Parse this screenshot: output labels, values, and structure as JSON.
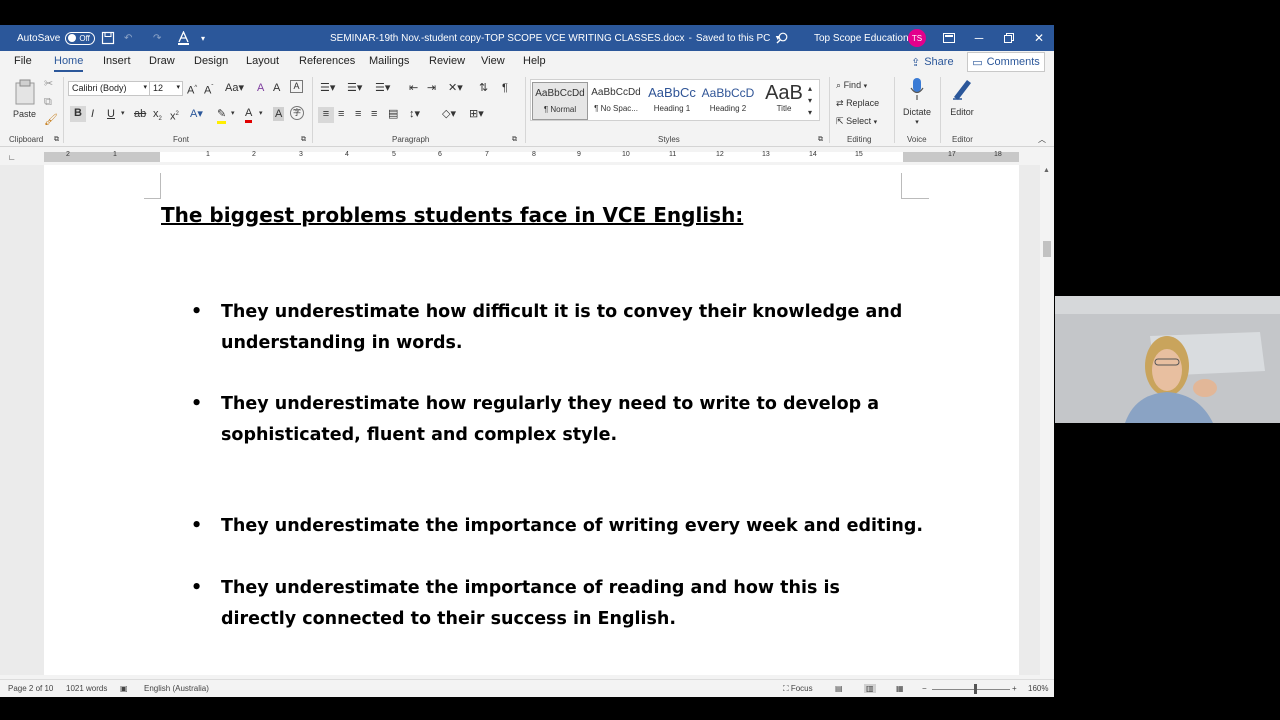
{
  "titlebar": {
    "autosave_label": "AutoSave",
    "autosave_state": "Off",
    "document_title": "SEMINAR-19th Nov.-student copy-TOP SCOPE VCE WRITING CLASSES.docx",
    "save_status": "Saved to this PC",
    "account_name": "Top Scope Education",
    "avatar_initials": "TS",
    "accent_color": "#2b579a"
  },
  "menu": {
    "tabs": [
      "File",
      "Home",
      "Insert",
      "Draw",
      "Design",
      "Layout",
      "References",
      "Mailings",
      "Review",
      "View",
      "Help"
    ],
    "active_tab": "Home",
    "share_label": "Share",
    "comments_label": "Comments"
  },
  "ribbon": {
    "clipboard": {
      "paste_label": "Paste",
      "group_label": "Clipboard"
    },
    "font": {
      "font_name": "Calibri (Body)",
      "font_size": "12",
      "group_label": "Font"
    },
    "paragraph": {
      "group_label": "Paragraph"
    },
    "styles": {
      "group_label": "Styles",
      "items": [
        {
          "sample": "AaBbCcDd",
          "name": "¶ Normal"
        },
        {
          "sample": "AaBbCcDd",
          "name": "¶ No Spac..."
        },
        {
          "sample": "AaBbCc",
          "name": "Heading 1"
        },
        {
          "sample": "AaBbCcD",
          "name": "Heading 2"
        },
        {
          "sample": "AaB",
          "name": "Title"
        }
      ]
    },
    "editing": {
      "find_label": "Find",
      "replace_label": "Replace",
      "select_label": "Select",
      "group_label": "Editing"
    },
    "voice": {
      "dictate_label": "Dictate",
      "group_label": "Voice"
    },
    "editor": {
      "editor_label": "Editor",
      "group_label": "Editor"
    }
  },
  "ruler": {
    "ticks": [
      "2",
      "1",
      "1",
      "2",
      "3",
      "4",
      "5",
      "6",
      "7",
      "8",
      "9",
      "10",
      "11",
      "12",
      "13",
      "14",
      "15",
      "17",
      "18"
    ]
  },
  "document": {
    "title": "The biggest problems students face in VCE English:",
    "bullets": [
      {
        "text": "They underestimate how difficult it is to convey their knowledge and understanding in words."
      },
      {
        "text": "They underestimate how regularly they need to write to develop a sophisticated, fluent and complex style."
      },
      {
        "text": "They underestimate the importance of writing every week and editing."
      },
      {
        "text": "They underestimate the importance of reading and how this is directly connected to their success in English."
      }
    ]
  },
  "status": {
    "page": "Page 2 of 10",
    "words": "1021 words",
    "language": "English (Australia)",
    "focus_label": "Focus",
    "zoom": "160%"
  }
}
